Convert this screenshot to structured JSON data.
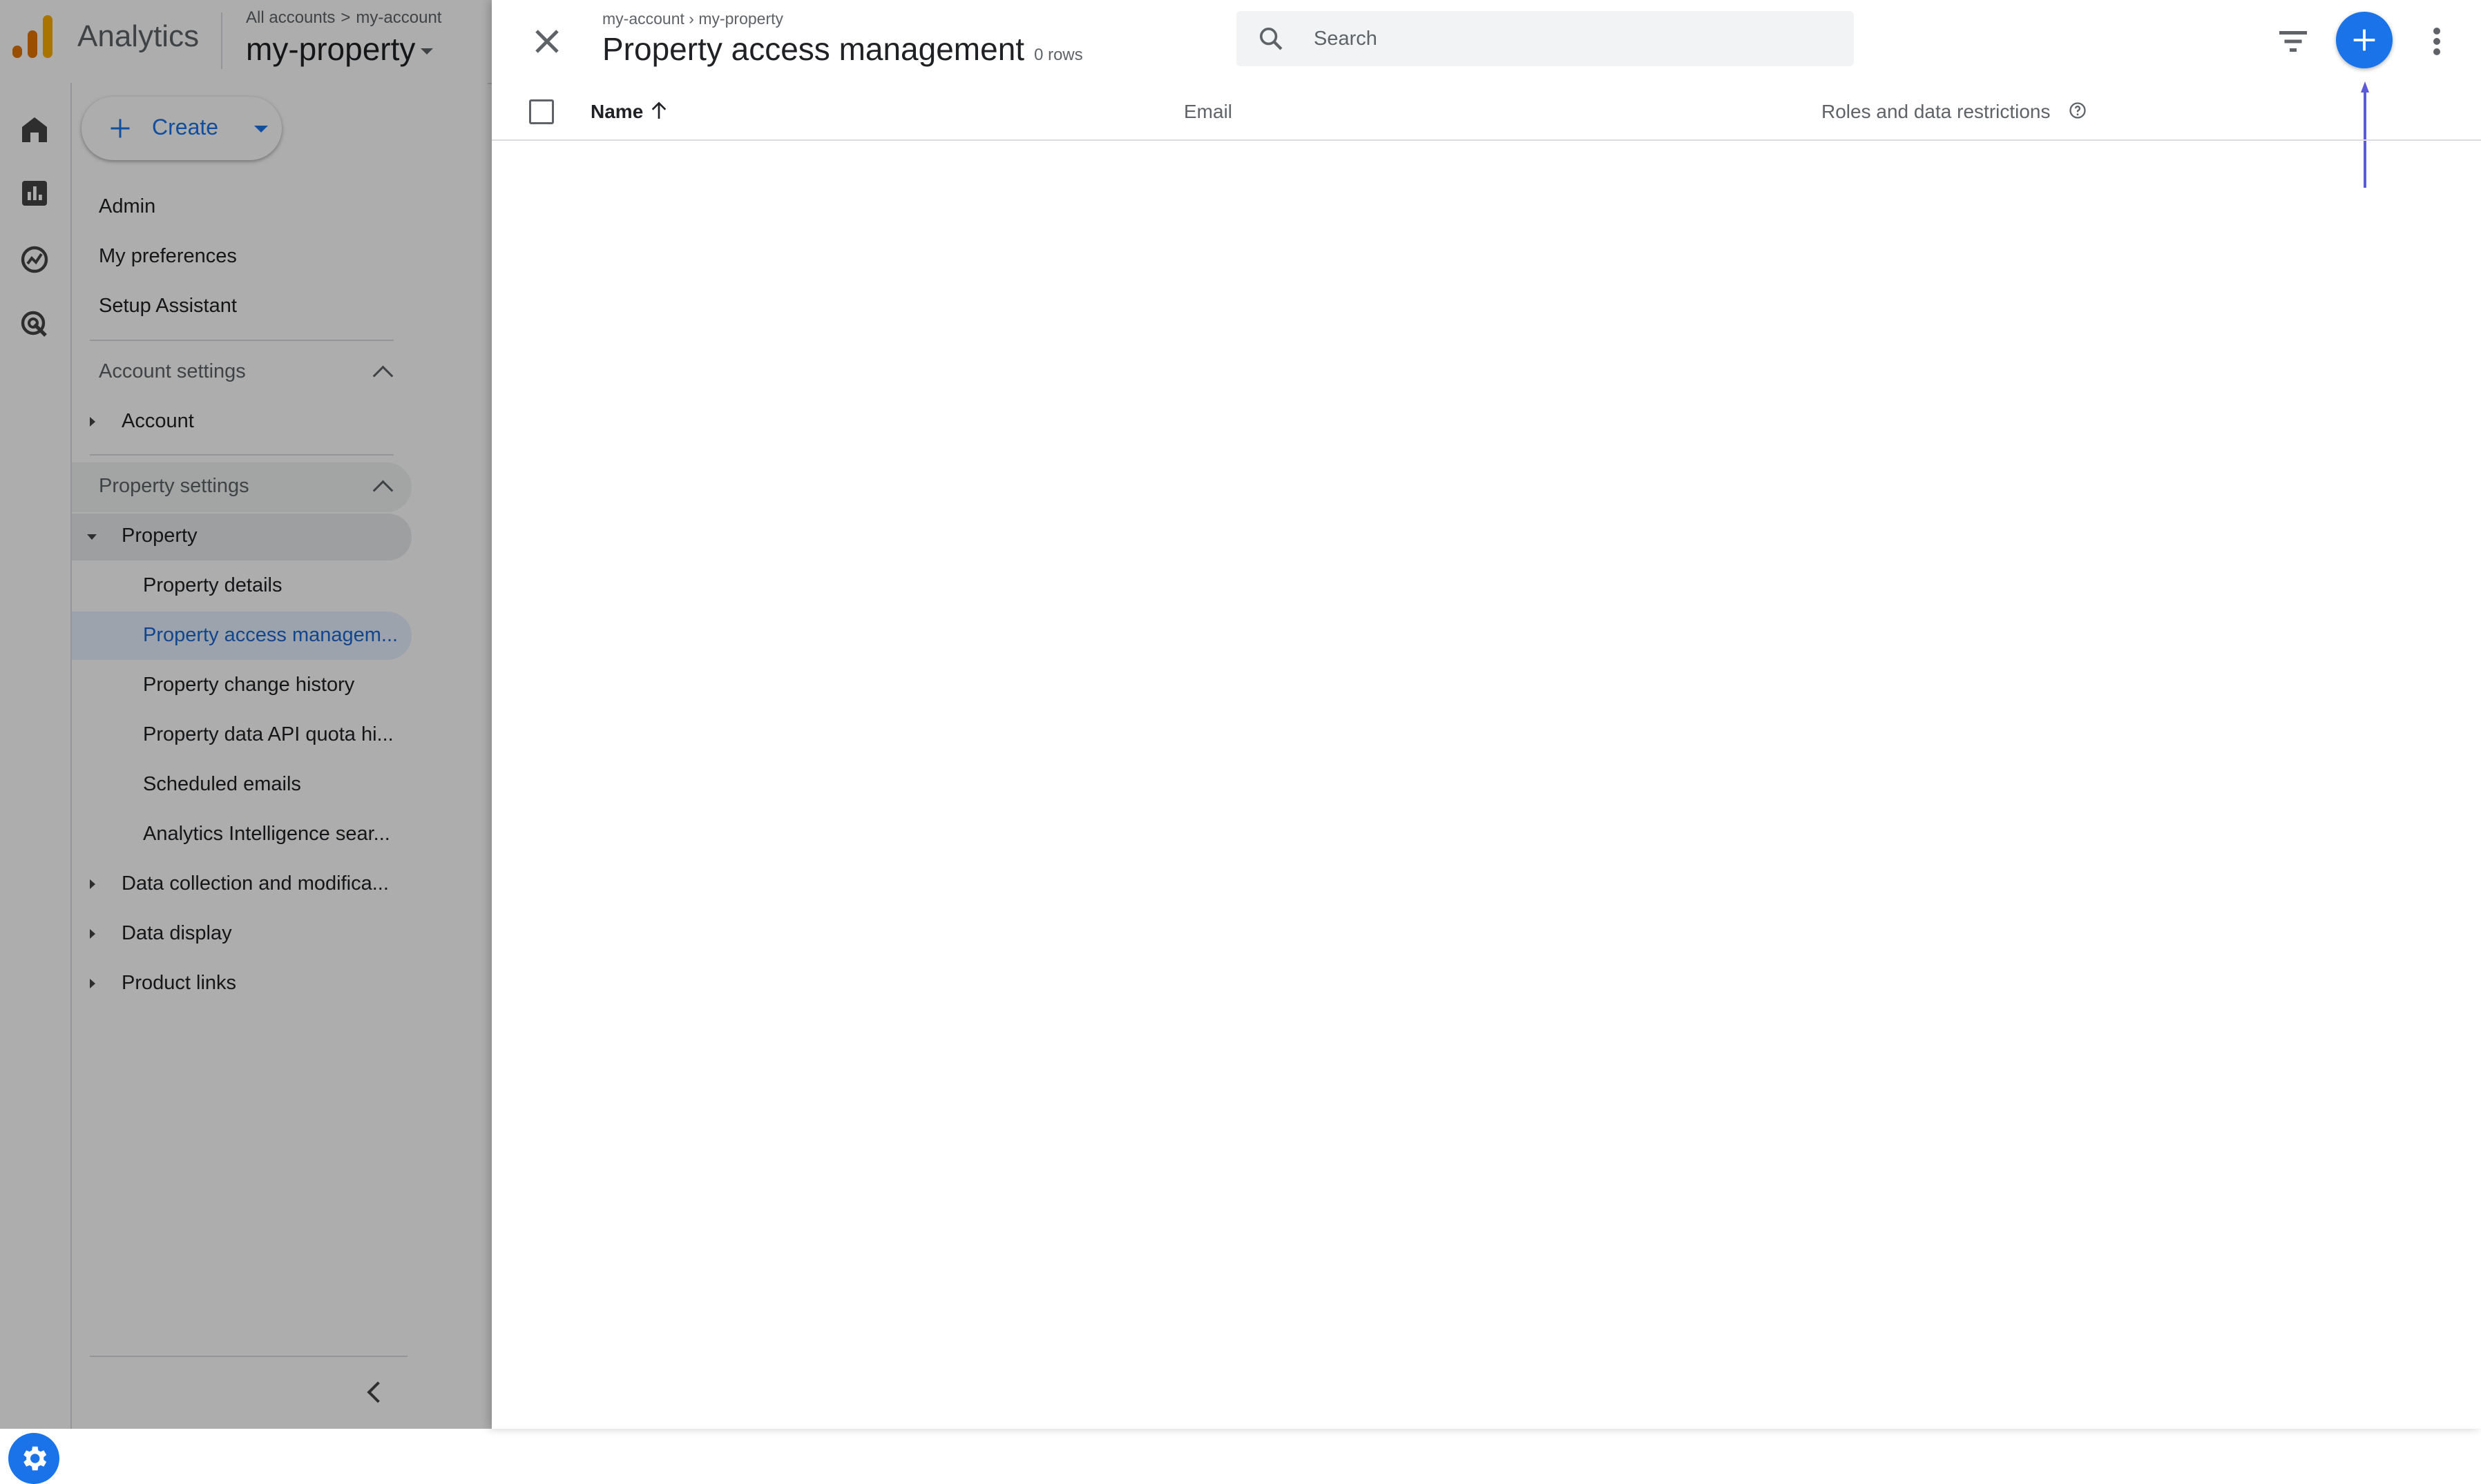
{
  "header": {
    "app_name": "Analytics",
    "breadcrumb_all": "All accounts",
    "breadcrumb_sep": ">",
    "breadcrumb_account": "my-account",
    "property_name": "my-property"
  },
  "sidenav": {
    "create_label": "Create",
    "top_items": [
      "Admin",
      "My preferences",
      "Setup Assistant"
    ],
    "account_settings_label": "Account settings",
    "account_label": "Account",
    "property_settings_label": "Property settings",
    "property_label": "Property",
    "property_children": [
      "Property details",
      "Property access managem...",
      "Property change history",
      "Property data API quota hi...",
      "Scheduled emails",
      "Analytics Intelligence sear..."
    ],
    "other_sections": [
      "Data collection and modifica...",
      "Data display",
      "Product links"
    ]
  },
  "panel": {
    "breadcrumb": "my-account › my-property",
    "title": "Property access management",
    "row_count": "0 rows",
    "search_placeholder": "Search",
    "columns": {
      "name": "Name",
      "email": "Email",
      "roles": "Roles and data restrictions"
    },
    "rows": []
  },
  "colors": {
    "accent": "#1a73e8",
    "logo_orange": "#f9ab00",
    "logo_dark_orange": "#e37400",
    "selected_item_bg": "#e8f0fe",
    "annotation_arrow": "#5b5bd6"
  },
  "icons": [
    "analytics-logo-icon",
    "home-icon",
    "reports-icon",
    "explore-icon",
    "advertising-icon",
    "settings-gear-icon",
    "plus-icon",
    "dropdown-arrow-icon",
    "chevron-up-icon",
    "expand-arrow-icon",
    "collapse-chevron-icon",
    "close-icon",
    "search-icon",
    "filter-icon",
    "add-icon",
    "more-vert-icon",
    "sort-arrow-up-icon",
    "help-circle-icon"
  ]
}
